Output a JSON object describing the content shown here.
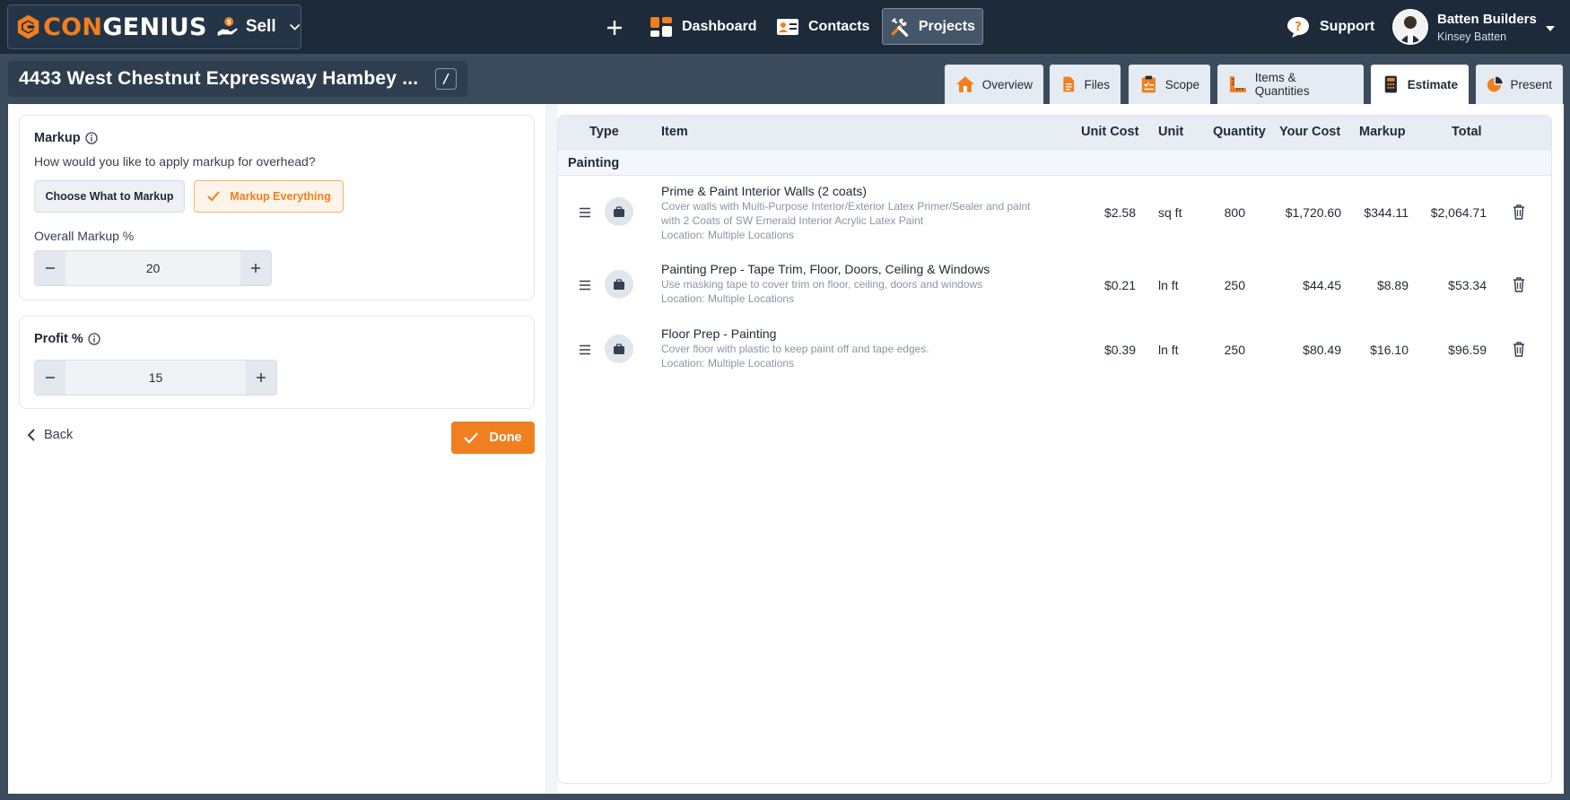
{
  "app": {
    "brand_prefix": "CON",
    "brand_suffix": "GENIUS",
    "mode_label": "Sell",
    "accent_color": "#f07f1f"
  },
  "nav": {
    "items": [
      {
        "label": "Dashboard",
        "icon": "dashboard-icon"
      },
      {
        "label": "Contacts",
        "icon": "contact-card-icon"
      },
      {
        "label": "Projects",
        "icon": "tools-icon",
        "active": true
      }
    ],
    "support_label": "Support"
  },
  "account": {
    "company": "Batten Builders",
    "user": "Kinsey Batten"
  },
  "project": {
    "title": "4433 West Chestnut Expressway Hambey ..."
  },
  "tabs": [
    {
      "label": "Overview",
      "icon": "home-icon"
    },
    {
      "label": "Files",
      "icon": "file-icon"
    },
    {
      "label": "Scope",
      "icon": "clipboard-icon"
    },
    {
      "label": "Items & Quantities",
      "icon": "ruler-icon"
    },
    {
      "label": "Estimate",
      "icon": "calculator-icon",
      "active": true
    },
    {
      "label": "Present",
      "icon": "pie-chart-icon"
    }
  ],
  "markup": {
    "title": "Markup",
    "question": "How would you like to apply markup for overhead?",
    "option_choose": "Choose What to Markup",
    "option_all": "Markup Everything",
    "selected_option": "Markup Everything",
    "overall_label": "Overall Markup %",
    "overall_value": "20"
  },
  "profit": {
    "title": "Profit %",
    "value": "15"
  },
  "actions": {
    "back": "Back",
    "done": "Done"
  },
  "table": {
    "columns": [
      "Type",
      "Item",
      "Unit Cost",
      "Unit",
      "Quantity",
      "Your Cost",
      "Markup",
      "Total"
    ],
    "group": "Painting",
    "rows": [
      {
        "name": "Prime & Paint Interior Walls (2 coats)",
        "description": "Cover walls with Multi-Purpose Interior/Exterior Latex Primer/Sealer and paint with 2 Coats of SW Emerald Interior Acrylic Latex Paint",
        "location": "Location: Multiple Locations",
        "unit_cost": "$2.58",
        "unit": "sq ft",
        "quantity": "800",
        "your_cost": "$1,720.60",
        "markup": "$344.11",
        "total": "$2,064.71"
      },
      {
        "name": "Painting Prep - Tape Trim, Floor, Doors, Ceiling & Windows",
        "description": "Use masking tape to cover trim on floor, ceiling, doors and windows",
        "location": "Location: Multiple Locations",
        "unit_cost": "$0.21",
        "unit": "ln ft",
        "quantity": "250",
        "your_cost": "$44.45",
        "markup": "$8.89",
        "total": "$53.34"
      },
      {
        "name": "Floor Prep - Painting",
        "description": "Cover floor with plastic to keep paint off and tape edges.",
        "location": "Location: Multiple Locations",
        "unit_cost": "$0.39",
        "unit": "ln ft",
        "quantity": "250",
        "your_cost": "$80.49",
        "markup": "$16.10",
        "total": "$96.59"
      }
    ]
  }
}
